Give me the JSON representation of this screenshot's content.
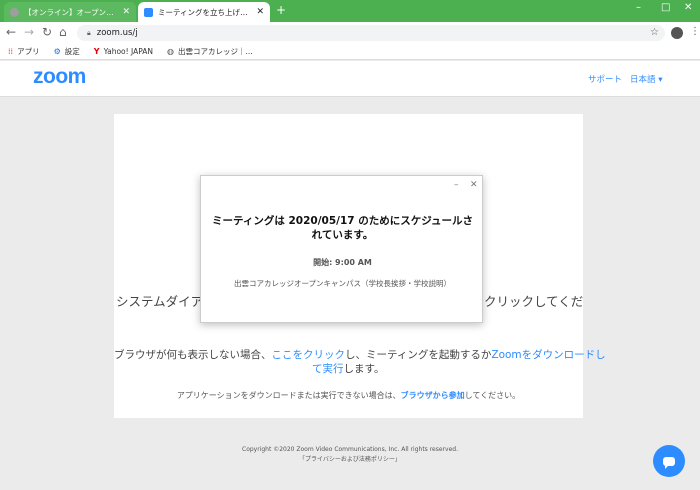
{
  "browser": {
    "tabs": [
      {
        "title": "【オンライン】オープンキャンパスについて",
        "active": false
      },
      {
        "title": "ミーティングを立ち上げる - Zoom",
        "active": true
      }
    ],
    "new_tab": "+",
    "window_controls": {
      "minimize": "–",
      "maximize": "□",
      "close": "✕"
    },
    "url": "zoom.us/j",
    "bookmarks": [
      {
        "label": "アプリ",
        "icon": "apps-grid-icon"
      },
      {
        "label": "設定",
        "icon": "gear-icon"
      },
      {
        "label": "Yahoo! JAPAN",
        "icon": "yahoo-icon"
      },
      {
        "label": "出雲コアカレッジ｜...",
        "icon": "globe-icon"
      }
    ]
  },
  "header": {
    "logo": "zoom",
    "support": "サポート",
    "language": "日本語 ▾"
  },
  "main": {
    "system_dialog_text_left": "システムダイア",
    "system_dialog_text_right": "クリックしてくだ",
    "help": {
      "prefix": "ブラウザが何も表示しない場合、",
      "click_here": "ここをクリック",
      "middle": "し、ミーティングを起動するか",
      "download": "Zoomをダウンロードし",
      "download2": "て実行",
      "suffix": "します。"
    },
    "app_help": {
      "prefix": "アプリケーションをダウンロードまたは実行できない場合は、",
      "link": "ブラウザから参加",
      "suffix": "してください。"
    }
  },
  "footer": {
    "copyright": "Copyright ©2020 Zoom Video Communications, Inc. All rights reserved.",
    "policy": "「プライバシーおよび法務ポリシー」"
  },
  "modal": {
    "minimize": "–",
    "close": "✕",
    "heading_line1": "ミーティングは 2020/05/17 のためにスケジュールさ",
    "heading_line2": "れています。",
    "start": "開始: 9:00 AM",
    "meeting_title": "出雲コアカレッジオープンキャンパス（学校長挨拶・学校説明）"
  },
  "colors": {
    "accent": "#2d8cff",
    "titlebar": "#4caf50"
  }
}
